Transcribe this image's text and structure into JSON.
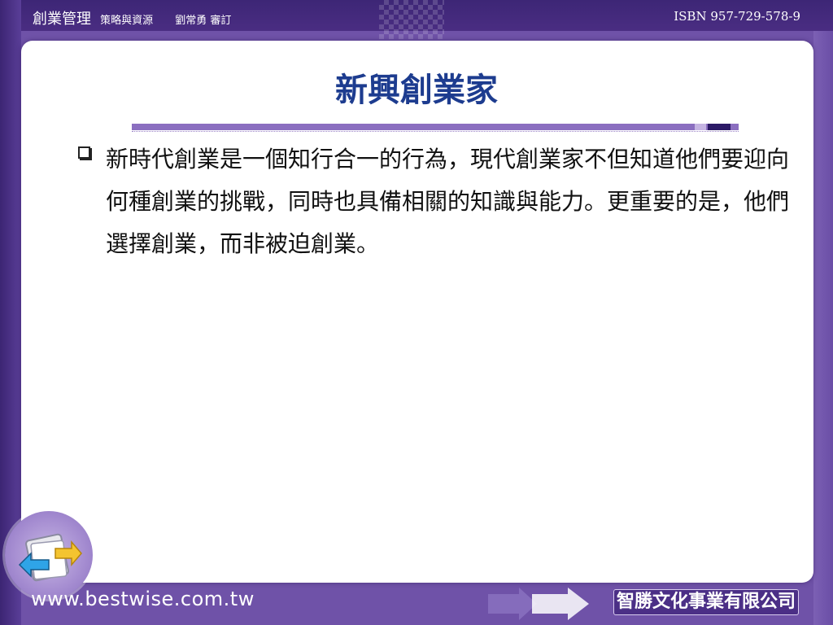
{
  "header": {
    "book_title": "創業管理",
    "subtitle": "策略與資源",
    "reviewer": "劉常勇 審訂",
    "isbn": "ISBN 957-729-578-9"
  },
  "slide": {
    "title": "新興創業家",
    "bullets": [
      "新時代創業是一個知行合一的行為，現代創業家不但知道他們要迎向何種創業的挑戰，同時也具備相關的知識與能力。更重要的是，他們選擇創業，而非被迫創業。"
    ]
  },
  "footer": {
    "url": "www.bestwise.com.tw",
    "company": "智勝文化事業有限公司"
  },
  "colors": {
    "title": "#1d3c8f",
    "background": "#6f52a8",
    "accent": "#8b6fc0"
  },
  "icons": [
    "back-arrow-icon",
    "forward-arrow-icon",
    "folder-icon"
  ]
}
